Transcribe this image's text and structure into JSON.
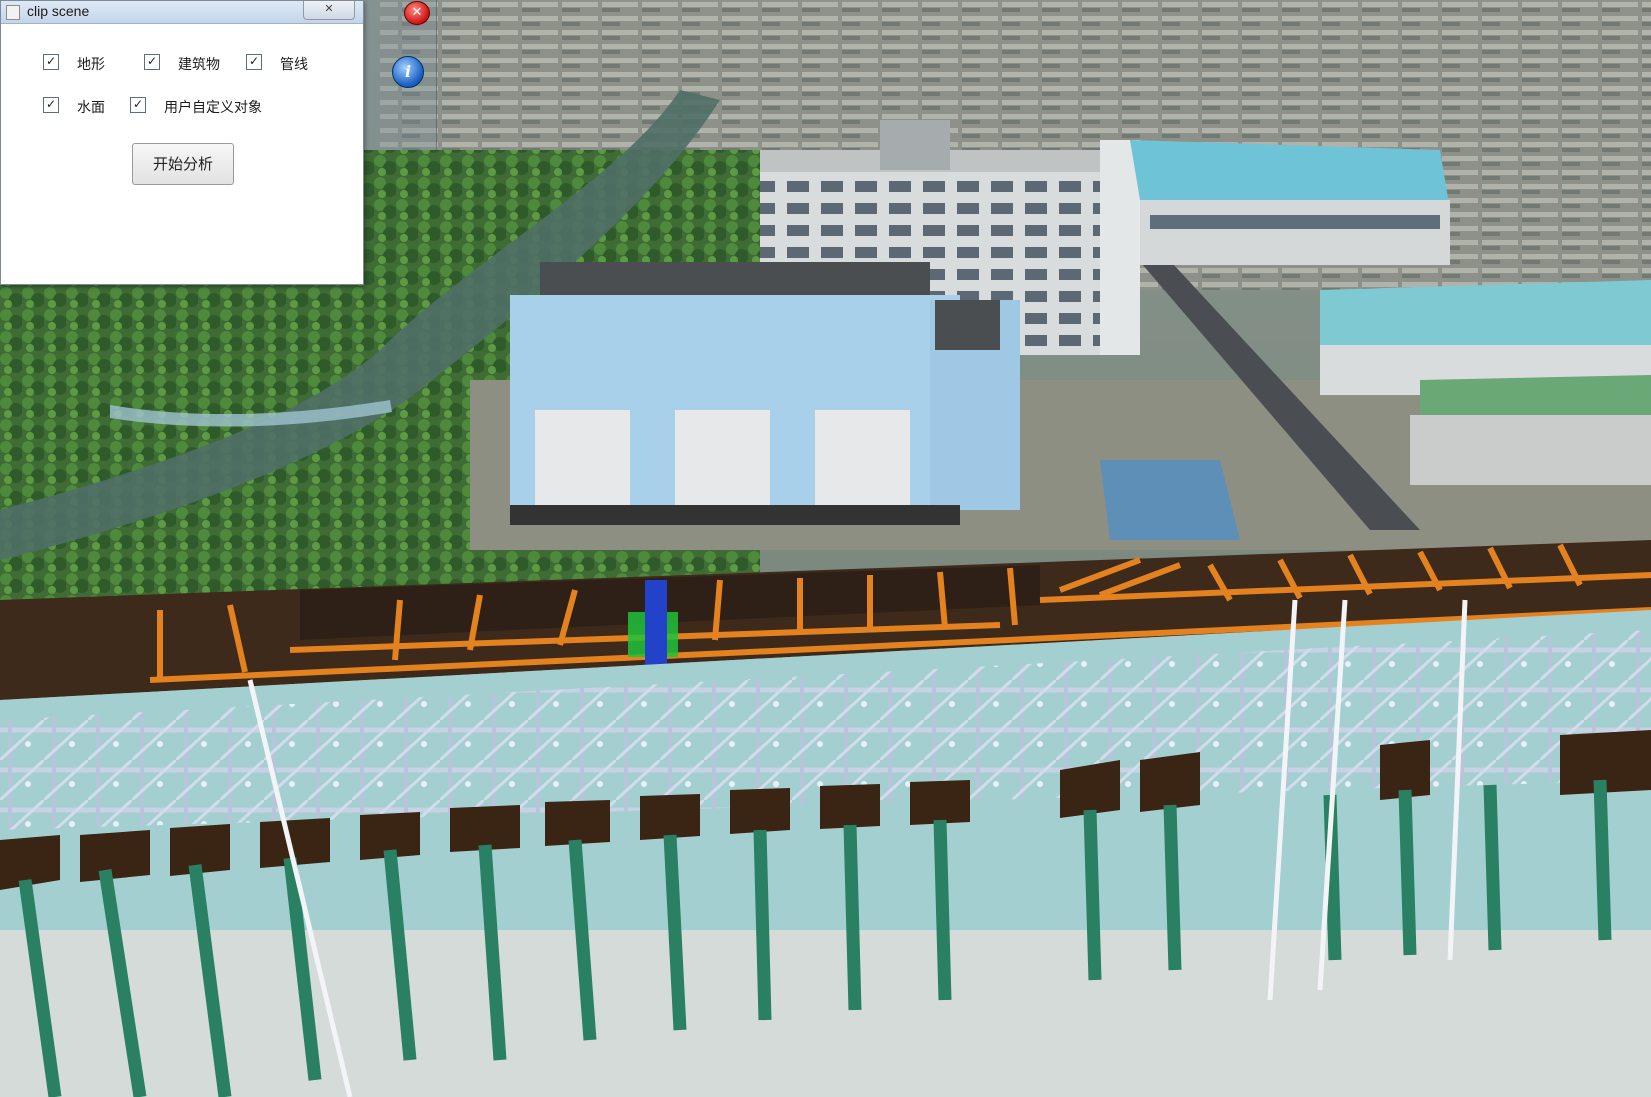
{
  "window": {
    "title": "clip scene",
    "close_label": "✕"
  },
  "options": [
    {
      "label": "地形",
      "checked": true
    },
    {
      "label": "建筑物",
      "checked": true
    },
    {
      "label": "管线",
      "checked": true
    },
    {
      "label": "水面",
      "checked": true
    },
    {
      "label": "用户自定义对象",
      "checked": true
    }
  ],
  "checkmark": "✓",
  "start_button": "开始分析",
  "overlay": {
    "close_icon": "close-icon",
    "close_glyph": "✕",
    "info_icon": "info-icon",
    "info_glyph": "i"
  },
  "colors": {
    "pipe_orange": "#e3821f",
    "pipe_white": "#cfd6e6",
    "pile_green": "#2a8062",
    "clip_plane": "#a3cfd0",
    "soil_brown": "#3d2a1b"
  }
}
